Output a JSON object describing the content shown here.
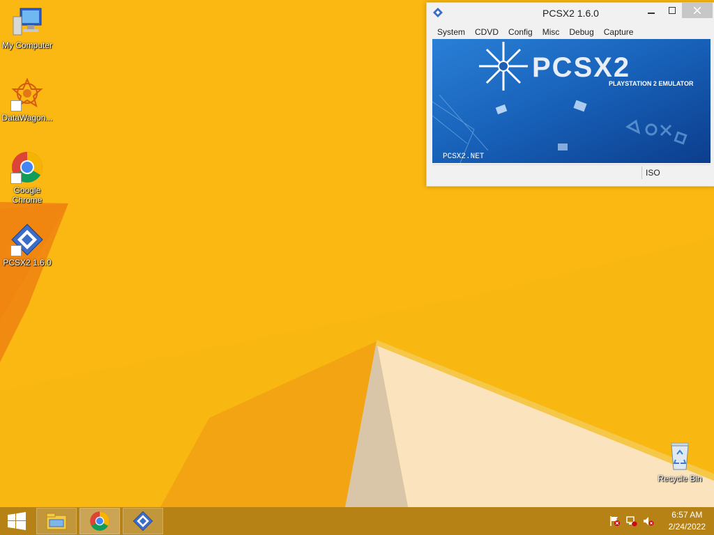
{
  "desktop": {
    "icons": [
      {
        "label": "My Computer",
        "icon": "computer-icon"
      },
      {
        "label": "DataWagon...",
        "icon": "datawagon-icon"
      },
      {
        "label": "Google Chrome",
        "icon": "chrome-icon"
      },
      {
        "label": "PCSX2 1.6.0",
        "icon": "pcsx2-icon"
      },
      {
        "label": "Recycle Bin",
        "icon": "recycle-bin-icon"
      }
    ]
  },
  "window": {
    "title": "PCSX2  1.6.0",
    "menu": [
      "System",
      "CDVD",
      "Config",
      "Misc",
      "Debug",
      "Capture"
    ],
    "banner": {
      "logo": "PCSX2",
      "subtitle": "PLAYSTATION 2 EMULATOR",
      "url": "PCSX2.NET"
    },
    "status": {
      "mode": "ISO"
    }
  },
  "taskbar": {
    "apps": [
      "file-explorer-icon",
      "chrome-icon",
      "pcsx2-icon"
    ],
    "tray": [
      "action-center-flag-icon",
      "network-icon",
      "volume-muted-icon"
    ],
    "clock": {
      "time": "6:57 AM",
      "date": "2/24/2022"
    }
  },
  "colors": {
    "wallpaper": "#f9b711",
    "taskbar": "#a87616",
    "banner": "#1a5fb4"
  }
}
